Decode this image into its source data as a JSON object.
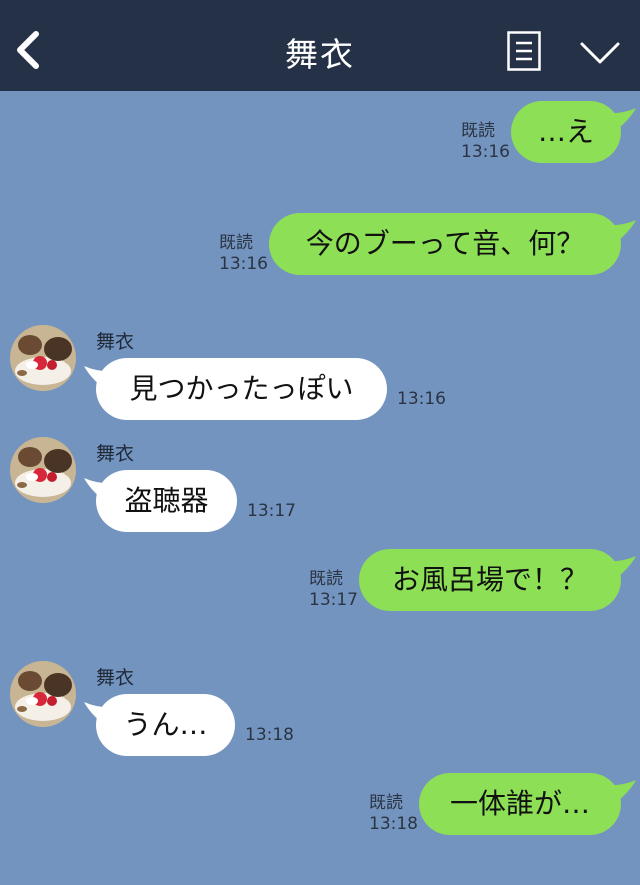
{
  "header": {
    "title": "舞衣",
    "bg_color": "#243146",
    "back_icon": "chevron-left-icon",
    "menu_icon": "list-icon",
    "dropdown_icon": "chevron-down-icon"
  },
  "chat_bg_color": "#7494c0",
  "messages": [
    {
      "dir": "out",
      "text": "…え",
      "read": "既読",
      "time": "13:16"
    },
    {
      "dir": "out",
      "text": "今のブーって音、何？",
      "read": "既読",
      "time": "13:16"
    },
    {
      "dir": "in",
      "sender": "舞衣",
      "text": "見つかったっぽい",
      "time": "13:16"
    },
    {
      "dir": "in",
      "sender": "舞衣",
      "text": "盗聴器",
      "time": "13:17"
    },
    {
      "dir": "out",
      "text": "お風呂場で！？",
      "read": "既読",
      "time": "13:17"
    },
    {
      "dir": "in",
      "sender": "舞衣",
      "text": "うん…",
      "time": "13:18"
    },
    {
      "dir": "out",
      "text": "一体誰が…",
      "read": "既読",
      "time": "13:18"
    }
  ]
}
